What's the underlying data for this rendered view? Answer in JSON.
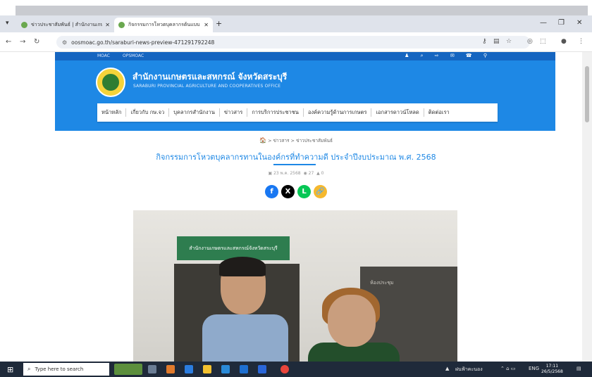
{
  "browser": {
    "tabs": [
      {
        "label": "ข่าวประชาสัมพันธ์ | สำนักงานเกษ...",
        "active": false
      },
      {
        "label": "กิจกรรมการโหวตบุคลากรต้นแบบ",
        "active": true
      }
    ],
    "new_tab": "+",
    "url": "oosmoac.go.th/saraburi-news-preview-471291792248",
    "window_controls": {
      "minimize": "—",
      "maximize": "❐",
      "close": "✕"
    }
  },
  "site_topbar": {
    "link1": "MOAC",
    "link2": "OPSMOAC"
  },
  "header": {
    "org_name_th": "สำนักงานเกษตรและสหกรณ์ จังหวัดสระบุรี",
    "org_name_en": "SARABURI PROVINCIAL AGRICULTURE AND COOPERATIVES OFFICE",
    "menu": [
      "หน้าหลัก",
      "เกี่ยวกับ กษ.จว",
      "บุคลากรสำนักงาน",
      "ข่าวสาร",
      "การบริการประชาชน",
      "องค์ความรู้ด้านการเกษตร",
      "เอกสารดาวน์โหลด",
      "ติดต่อเรา"
    ]
  },
  "article": {
    "breadcrumb": [
      "ข่าวสาร",
      "ข่าวประชาสัมพันธ์"
    ],
    "title": "กิจกรรมการโหวตบุคลากรทานในองค์กรที่ทำความดี ประจำปีงบประมาณ พ.ศ. 2568",
    "date": "23 พ.ค. 2568",
    "views": "27",
    "comments": "0",
    "share": [
      "f",
      "X",
      "L",
      "🔗"
    ],
    "photo_sign": "สำนักงานเกษตรและสหกรณ์จังหวัดสระบุรี",
    "photo_sign2": "ห้องประชุม"
  },
  "taskbar": {
    "search_placeholder": "Type here to search",
    "weather": "ฝนฟ้าคะนอง",
    "lang": "ENG",
    "time": "17:11",
    "date": "26/5/2568"
  },
  "colors": {
    "brand_blue": "#1e88e5",
    "dark_blue": "#1565c0",
    "share_facebook": "#1877f2",
    "share_x": "#000000",
    "share_line": "#06c755",
    "share_link": "#f5b82e"
  }
}
